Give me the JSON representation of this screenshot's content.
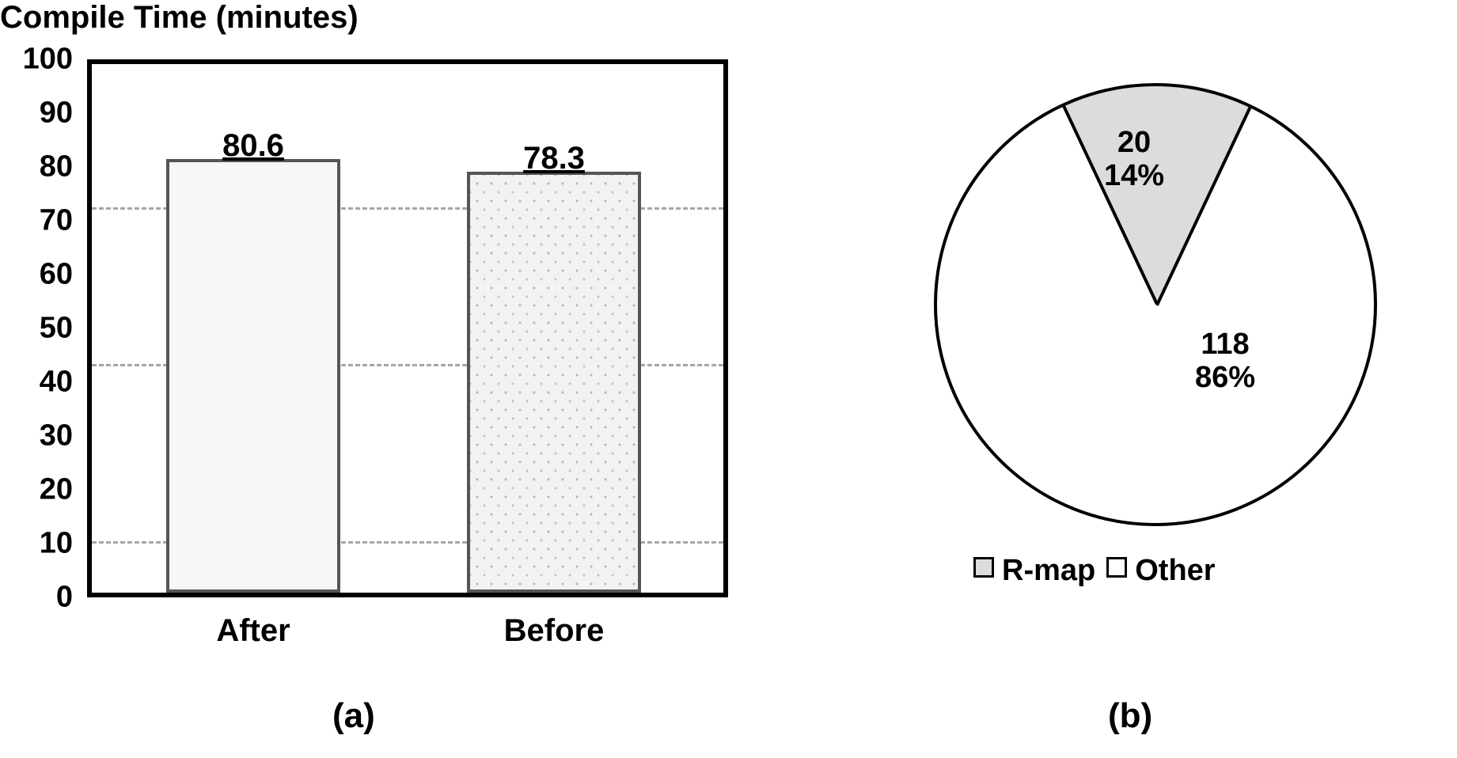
{
  "chart_data": [
    {
      "type": "bar",
      "title": "Compile Time (minutes)",
      "categories": [
        "After",
        "Before"
      ],
      "values": [
        80.6,
        78.3
      ],
      "ylim": [
        0,
        100
      ],
      "yticks": [
        0,
        10,
        20,
        30,
        40,
        50,
        60,
        70,
        80,
        90,
        100
      ],
      "gridlines": [
        10,
        43,
        72
      ],
      "xlabel": "",
      "ylabel": "",
      "subplot_label": "(a)"
    },
    {
      "type": "pie",
      "series": [
        {
          "name": "R-map",
          "value": 20,
          "percent": "14%"
        },
        {
          "name": "Other",
          "value": 118,
          "percent": "86%"
        }
      ],
      "legend": [
        "R-map",
        "Other"
      ],
      "subplot_label": "(b)"
    }
  ]
}
